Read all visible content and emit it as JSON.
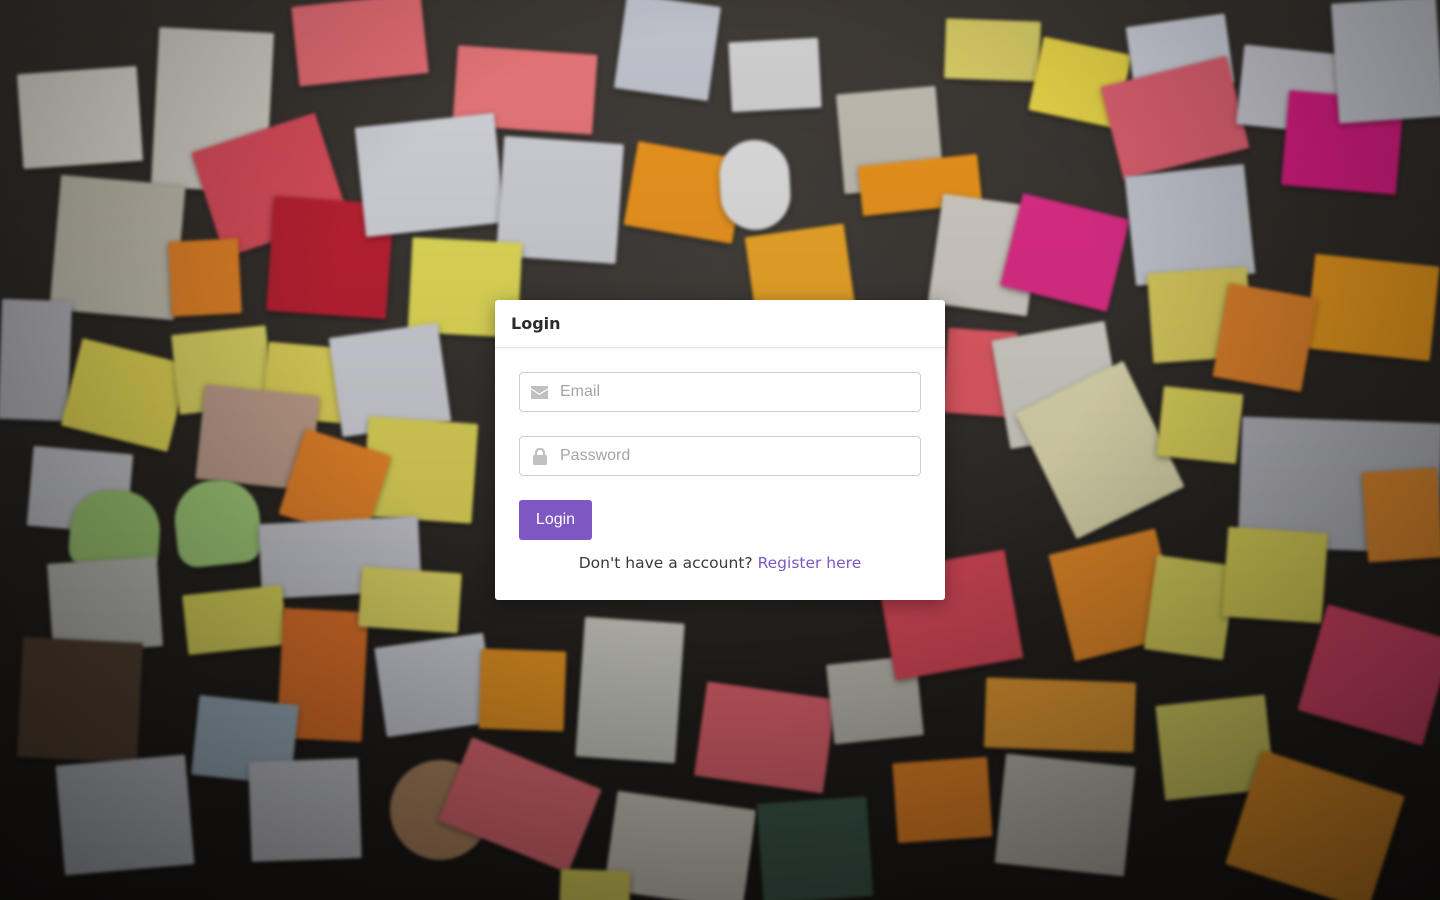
{
  "background": {
    "description_icon": "sticky-notes-wall-background"
  },
  "login_card": {
    "title": "Login",
    "email": {
      "placeholder": "Email",
      "value": "",
      "icon": "envelope-icon"
    },
    "password": {
      "placeholder": "Password",
      "value": "",
      "icon": "lock-icon"
    },
    "submit_label": "Login",
    "register_prompt": "Don't have a account?",
    "register_link": "Register here"
  },
  "colors": {
    "accent": "#7e57c2",
    "card_background": "#ffffff",
    "icon_grey": "#c0c0c0"
  }
}
